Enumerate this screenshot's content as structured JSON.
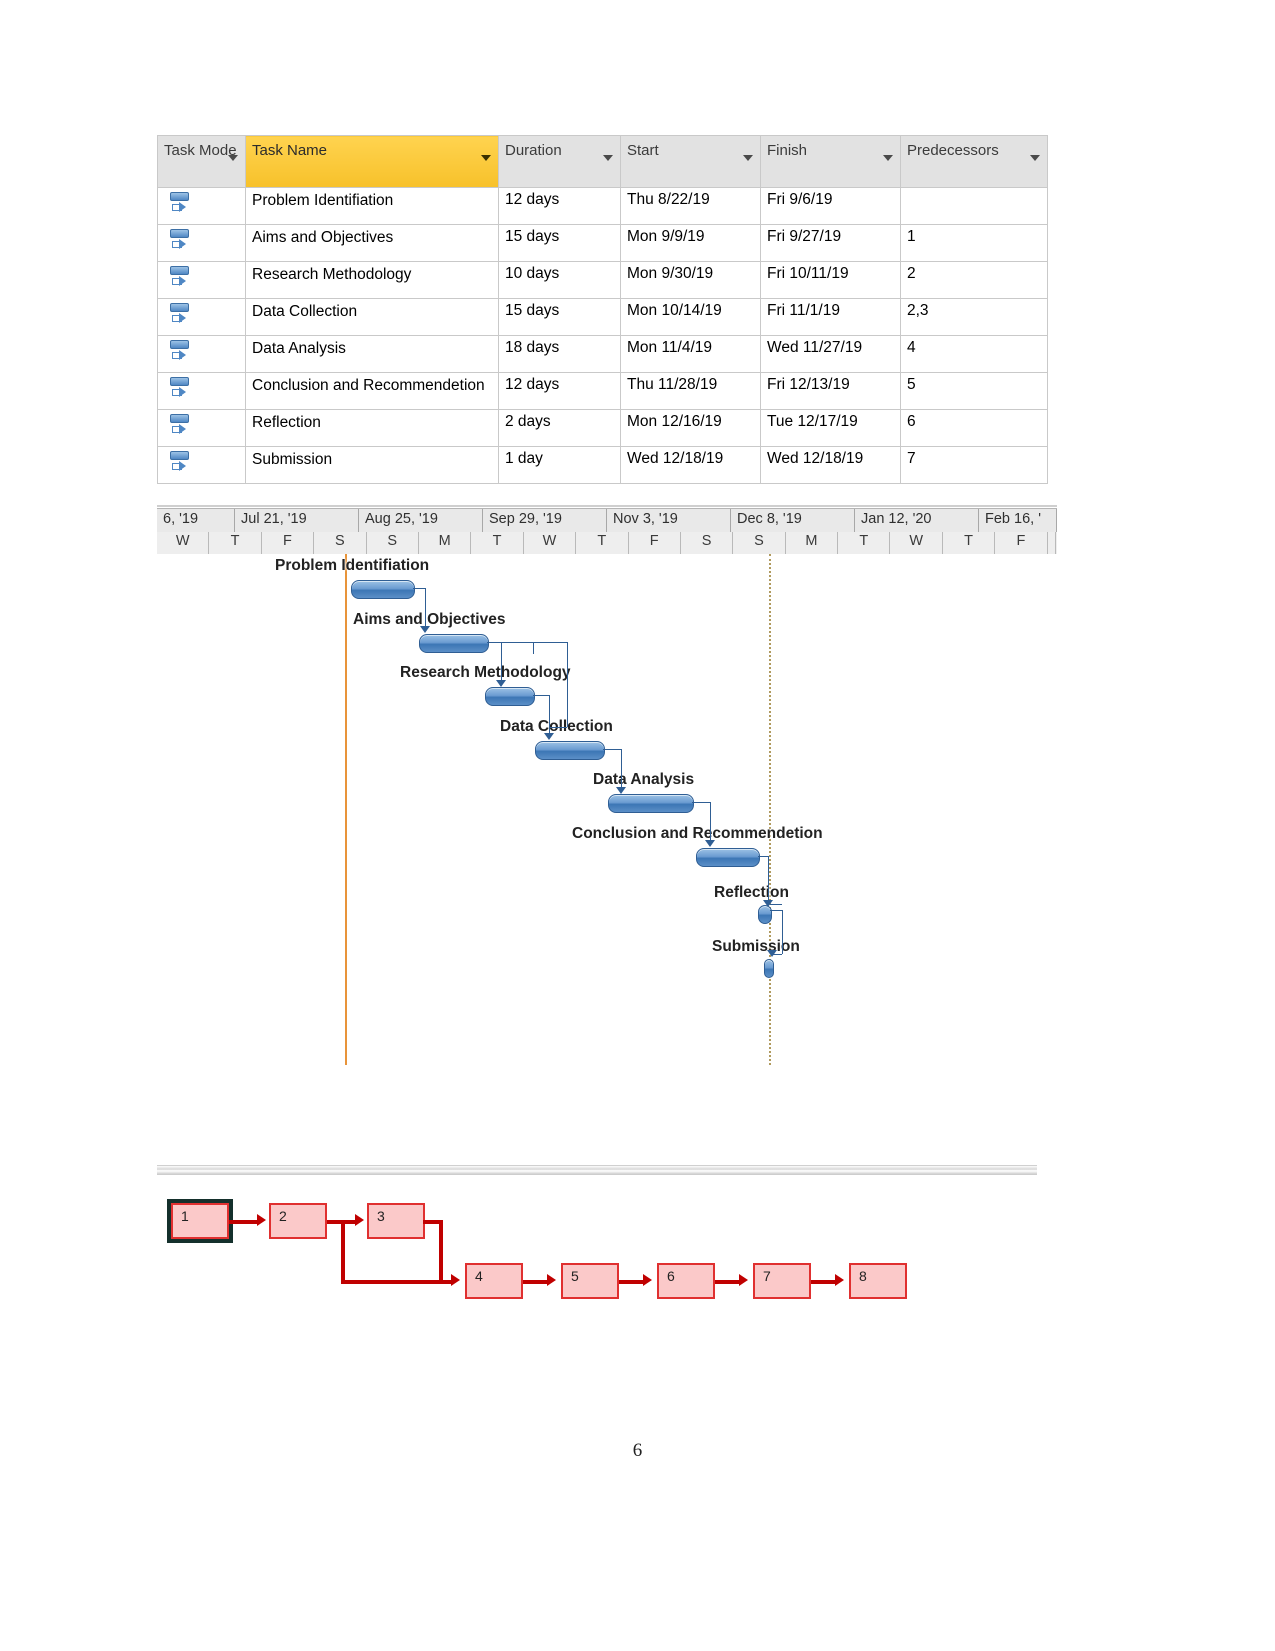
{
  "table": {
    "columns": [
      {
        "label": "Task Mode",
        "key": "mode",
        "highlight": false
      },
      {
        "label": "Task Name",
        "key": "name",
        "highlight": true
      },
      {
        "label": "Duration",
        "key": "duration",
        "highlight": false
      },
      {
        "label": "Start",
        "key": "start",
        "highlight": false
      },
      {
        "label": "Finish",
        "key": "finish",
        "highlight": false
      },
      {
        "label": "Predecessors",
        "key": "predecessors",
        "highlight": false
      }
    ],
    "rows": [
      {
        "id": 1,
        "mode_icon": "auto-schedule-icon",
        "name": "Problem Identifiation",
        "duration": "12 days",
        "start": "Thu 8/22/19",
        "finish": "Fri 9/6/19",
        "predecessors": ""
      },
      {
        "id": 2,
        "mode_icon": "auto-schedule-icon",
        "name": "Aims and Objectives",
        "duration": "15 days",
        "start": "Mon 9/9/19",
        "finish": "Fri 9/27/19",
        "predecessors": "1"
      },
      {
        "id": 3,
        "mode_icon": "auto-schedule-icon",
        "name": "Research Methodology",
        "duration": "10 days",
        "start": "Mon 9/30/19",
        "finish": "Fri 10/11/19",
        "predecessors": "2"
      },
      {
        "id": 4,
        "mode_icon": "auto-schedule-icon",
        "name": "Data Collection",
        "duration": "15 days",
        "start": "Mon 10/14/19",
        "finish": "Fri 11/1/19",
        "predecessors": "2,3"
      },
      {
        "id": 5,
        "mode_icon": "auto-schedule-icon",
        "name": "Data Analysis",
        "duration": "18 days",
        "start": "Mon 11/4/19",
        "finish": "Wed 11/27/19",
        "predecessors": "4"
      },
      {
        "id": 6,
        "mode_icon": "auto-schedule-icon",
        "name": "Conclusion and Recommendetion",
        "duration": "12 days",
        "start": "Thu 11/28/19",
        "finish": "Fri 12/13/19",
        "predecessors": "5"
      },
      {
        "id": 7,
        "mode_icon": "auto-schedule-icon",
        "name": "Reflection",
        "duration": "2 days",
        "start": "Mon 12/16/19",
        "finish": "Tue 12/17/19",
        "predecessors": "6"
      },
      {
        "id": 8,
        "mode_icon": "auto-schedule-icon",
        "name": "Submission",
        "duration": "1 day",
        "start": "Wed 12/18/19",
        "finish": "Wed 12/18/19",
        "predecessors": "7"
      }
    ]
  },
  "chart_data": {
    "type": "gantt",
    "title": "Project Schedule Gantt Chart",
    "timescale": {
      "months": [
        "6, '19",
        "Jul 21, '19",
        "Aug 25, '19",
        "Sep 29, '19",
        "Nov 3, '19",
        "Dec 8, '19",
        "Jan 12, '20",
        "Feb 16, '"
      ],
      "days": [
        "W",
        "T",
        "F",
        "S",
        "S",
        "M",
        "T",
        "W",
        "T",
        "F",
        "S",
        "S",
        "M",
        "T",
        "W",
        "T",
        "F",
        ""
      ],
      "today_marker": "orange-vertical-line",
      "status_marker": "dotted-vertical-line"
    },
    "tasks": [
      {
        "id": 1,
        "label": "Problem Identifiation",
        "start": "Thu 8/22/19",
        "finish": "Fri 9/6/19",
        "duration_days": 12
      },
      {
        "id": 2,
        "label": "Aims and Objectives",
        "start": "Mon 9/9/19",
        "finish": "Fri 9/27/19",
        "duration_days": 15
      },
      {
        "id": 3,
        "label": "Research Methodology",
        "start": "Mon 9/30/19",
        "finish": "Fri 10/11/19",
        "duration_days": 10
      },
      {
        "id": 4,
        "label": "Data Collection",
        "start": "Mon 10/14/19",
        "finish": "Fri 11/1/19",
        "duration_days": 15
      },
      {
        "id": 5,
        "label": "Data Analysis",
        "start": "Mon 11/4/19",
        "finish": "Wed 11/27/19",
        "duration_days": 18
      },
      {
        "id": 6,
        "label": "Conclusion and Recommendetion",
        "start": "Thu 11/28/19",
        "finish": "Fri 12/13/19",
        "duration_days": 12
      },
      {
        "id": 7,
        "label": "Reflection",
        "start": "Mon 12/16/19",
        "finish": "Tue 12/17/19",
        "duration_days": 2
      },
      {
        "id": 8,
        "label": "Submission",
        "start": "Wed 12/18/19",
        "finish": "Wed 12/18/19",
        "duration_days": 1
      }
    ],
    "dependencies": [
      {
        "from": 1,
        "to": 2
      },
      {
        "from": 2,
        "to": 3
      },
      {
        "from": 2,
        "to": 4
      },
      {
        "from": 3,
        "to": 4
      },
      {
        "from": 4,
        "to": 5
      },
      {
        "from": 5,
        "to": 6
      },
      {
        "from": 6,
        "to": 7
      },
      {
        "from": 7,
        "to": 8
      }
    ]
  },
  "network": {
    "nodes": [
      {
        "id": "1",
        "label": "1",
        "selected": true
      },
      {
        "id": "2",
        "label": "2",
        "selected": false
      },
      {
        "id": "3",
        "label": "3",
        "selected": false
      },
      {
        "id": "4",
        "label": "4",
        "selected": false
      },
      {
        "id": "5",
        "label": "5",
        "selected": false
      },
      {
        "id": "6",
        "label": "6",
        "selected": false
      },
      {
        "id": "7",
        "label": "7",
        "selected": false
      },
      {
        "id": "8",
        "label": "8",
        "selected": false
      }
    ],
    "edges": [
      {
        "from": "1",
        "to": "2"
      },
      {
        "from": "2",
        "to": "3"
      },
      {
        "from": "2",
        "to": "4"
      },
      {
        "from": "3",
        "to": "4"
      },
      {
        "from": "4",
        "to": "5"
      },
      {
        "from": "5",
        "to": "6"
      },
      {
        "from": "6",
        "to": "7"
      },
      {
        "from": "7",
        "to": "8"
      }
    ],
    "node_color": "#fbc9c9",
    "node_border_color": "#e03030",
    "edge_color": "#c00000"
  },
  "page": {
    "number": "6"
  }
}
